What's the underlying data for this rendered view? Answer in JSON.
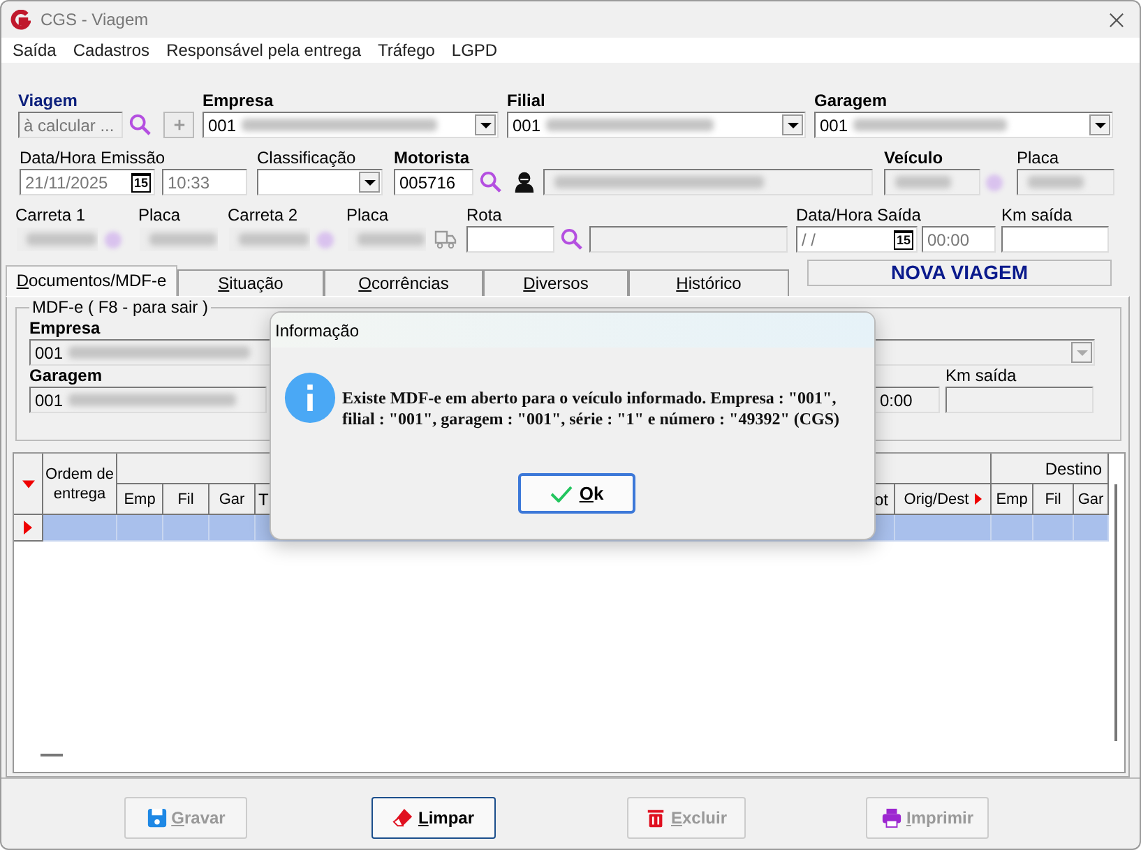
{
  "window": {
    "title": "CGS - Viagem"
  },
  "menu": [
    "Saída",
    "Cadastros",
    "Responsável pela entrega",
    "Tráfego",
    "LGPD"
  ],
  "form": {
    "viagem": {
      "label": "Viagem",
      "placeholder": "à calcular ..."
    },
    "empresa": {
      "label": "Empresa",
      "value": "001"
    },
    "filial": {
      "label": "Filial",
      "value": "001"
    },
    "garagem": {
      "label": "Garagem",
      "value": "001"
    },
    "emissao": {
      "label": "Data/Hora Emissão",
      "date": "21/11/2025",
      "calendar": "15",
      "time": "10:33"
    },
    "classificacao": {
      "label": "Classificação"
    },
    "motorista": {
      "label": "Motorista",
      "value": "005716"
    },
    "veiculo": {
      "label": "Veículo"
    },
    "placa": {
      "label": "Placa"
    },
    "carreta_1": {
      "label": "Carreta 1"
    },
    "placa_1": {
      "label": "Placa"
    },
    "carreta_2": {
      "label": "Carreta 2"
    },
    "placa_2": {
      "label": "Placa"
    },
    "rota": {
      "label": "Rota"
    },
    "saida": {
      "label": "Data/Hora Saída",
      "date": "/ /",
      "calendar": "15",
      "time": "00:00"
    },
    "km_saida": {
      "label": "Km saída"
    }
  },
  "tabs": [
    {
      "label": "Documentos/MDF-e",
      "selected": true
    },
    {
      "label": "Situação",
      "selected": false
    },
    {
      "label": "Ocorrências",
      "selected": false
    },
    {
      "label": "Diversos",
      "selected": false
    },
    {
      "label": "Histórico",
      "selected": false
    }
  ],
  "status": "NOVA VIAGEM",
  "mdfe": {
    "legend": "MDF-e ( F8 - para sair )",
    "empresa": {
      "label": "Empresa",
      "value": "001"
    },
    "garagem": {
      "label": "Garagem",
      "value": "001"
    },
    "time": "0:00",
    "km_saida": {
      "label": "Km saída"
    }
  },
  "grid": {
    "corner": "Ordem de entrega",
    "group_header": "Destino",
    "columns": [
      "Emp",
      "Fil",
      "Gar",
      "T",
      "ot",
      "Orig/Dest",
      "Emp",
      "Fil",
      "Gar"
    ],
    "rows": [
      {
        "selected": true
      }
    ]
  },
  "dialog": {
    "title": "Informação",
    "message": "Existe MDF-e em aberto para o veículo informado. Empresa : \"001\", filial : \"001\", garagem : \"001\", série : \"1\" e número : \"49392\" (CGS)",
    "button": "Ok"
  },
  "buttons": [
    {
      "kind": "save",
      "label": "Gravar",
      "disabled": true
    },
    {
      "kind": "clear",
      "label": "Limpar",
      "disabled": false
    },
    {
      "kind": "delete",
      "label": "Excluir",
      "disabled": true
    },
    {
      "kind": "print",
      "label": "Imprimir",
      "disabled": true
    }
  ]
}
